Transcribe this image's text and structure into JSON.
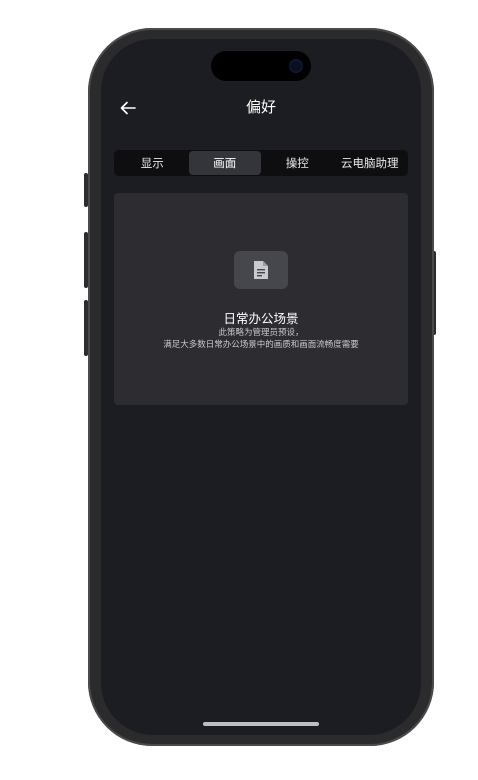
{
  "header": {
    "title": "偏好",
    "back_icon": "arrow-left-icon"
  },
  "tabs": [
    {
      "label": "显示",
      "active": false
    },
    {
      "label": "画面",
      "active": true
    },
    {
      "label": "操控",
      "active": false
    },
    {
      "label": "云电脑助理",
      "active": false
    }
  ],
  "scene_card": {
    "icon": "document-icon",
    "title": "日常办公场景",
    "description_line1": "此策略为管理员预设，",
    "description_line2": "满足大多数日常办公场景中的画质和画面流畅度需要"
  },
  "colors": {
    "screen_background": "#1c1d22",
    "card_background": "#2c2c31",
    "active_tab": "#34353b",
    "tab_bar": "#0e0e11"
  }
}
